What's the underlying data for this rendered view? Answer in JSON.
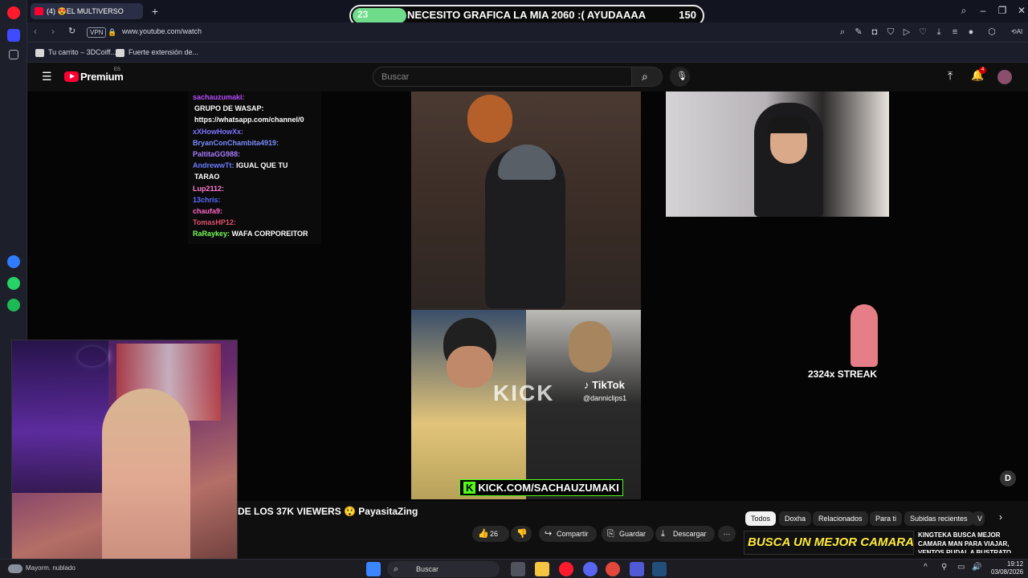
{
  "browser": {
    "tab_title": "(4) 😍EL MULTIVERSO",
    "url": "www.youtube.com/watch",
    "vpn_label": "VPN",
    "bookmarks": [
      "Tu carrito – 3DCoiff...",
      "Fuerte extensión de..."
    ],
    "ai_label": "AI"
  },
  "stream_goal": {
    "current": "23",
    "text": "NECESITO GRAFICA LA MIA 2060 :( AYUDAAAA",
    "target": "150",
    "progress_fraction": 0.153
  },
  "youtube": {
    "logo_text": "Premium",
    "region": "ES",
    "search_placeholder": "Buscar",
    "notification_count": "4"
  },
  "chat": {
    "lines": [
      {
        "user": "sachauzumaki:",
        "msg": "",
        "color": "#b94cff"
      },
      {
        "user": "",
        "msg": "GRUPO DE WASAP:",
        "color": "#ffffff"
      },
      {
        "user": "",
        "msg": "https://whatsapp.com/channel/0",
        "color": "#ffffff"
      },
      {
        "user": "xXHowHowXx:",
        "msg": "",
        "color": "#7d74ff"
      },
      {
        "user": "BryanConChambita4919:",
        "msg": "",
        "color": "#7b8cff"
      },
      {
        "user": "PaltitaGG988:",
        "msg": "",
        "color": "#a77bff"
      },
      {
        "user": "AndrewwTt:",
        "msg": "IGUAL QUE TU",
        "color": "#6c7dff"
      },
      {
        "user": "",
        "msg": "TARAO",
        "color": "#ffffff"
      },
      {
        "user": "Lup2112:",
        "msg": "",
        "color": "#ff7ad0"
      },
      {
        "user": "13chris:",
        "msg": "",
        "color": "#5d6dff"
      },
      {
        "user": "chaufa9:",
        "msg": "",
        "color": "#ff66c4"
      },
      {
        "user": "TomasHP12:",
        "msg": "",
        "color": "#e0506a"
      },
      {
        "user": "RaRaykey:",
        "msg": "WAFA CORPOREITOR",
        "color": "#79ff5a"
      }
    ]
  },
  "overlay": {
    "tiktok_label": "TikTok",
    "tiktok_user": "@danniclips1",
    "kick_watermark": "KICK",
    "kick_url": "KICK.COM/SACHAUZUMAKI",
    "streak": "2324x STREAK"
  },
  "video": {
    "title": "DE LOS 37K VIEWERS 😲 PayasitaZing",
    "like_count": "26",
    "share_label": "Compartir",
    "save_label": "Guardar",
    "download_label": "Descargar"
  },
  "related": {
    "chips": [
      "Todos",
      "Doxha",
      "Relacionados",
      "Para ti",
      "Subidas recientes",
      "V"
    ],
    "thumb_text": "BUSCA UN MEJOR CAMARA MAN",
    "title": "KINGTEKA BUSCA MEJOR CAMARA MAN PARA VIAJAR, VENTOS RUDAL A BUSTRATO"
  },
  "taskbar": {
    "weather": "Mayorm. nublado",
    "search_label": "Buscar",
    "time": "19:12",
    "date": "03/08/2026"
  }
}
